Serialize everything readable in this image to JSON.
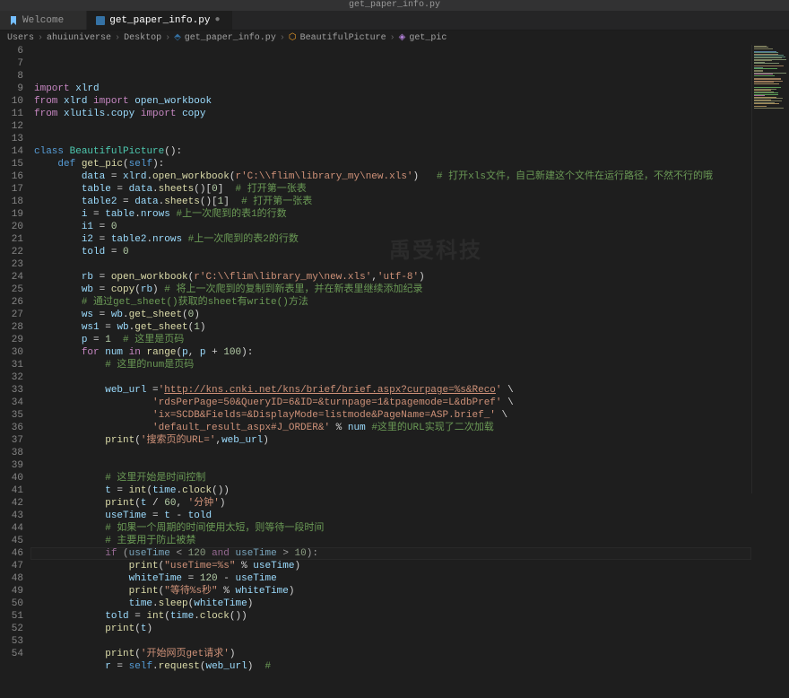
{
  "titlebar": "get_paper_info.py",
  "tabs": [
    {
      "icon": "bookmark-icon",
      "label": "Welcome",
      "active": false,
      "dirty": false
    },
    {
      "icon": "python-icon",
      "label": "get_paper_info.py",
      "active": true,
      "dirty": true
    }
  ],
  "breadcrumbs": [
    "Users",
    "ahuiuniverse",
    "Desktop",
    "get_paper_info.py",
    "BeautifulPicture",
    "get_pic"
  ],
  "crumb_icons": [
    "",
    "",
    "",
    "py",
    "class",
    "method"
  ],
  "watermark": "禹受科技",
  "lines": [
    {
      "n": 6,
      "tokens": [
        [
          "kw",
          "import"
        ],
        [
          "op",
          " "
        ],
        [
          "var",
          "xlrd"
        ]
      ]
    },
    {
      "n": 7,
      "tokens": [
        [
          "kw",
          "from"
        ],
        [
          "op",
          " "
        ],
        [
          "var",
          "xlrd"
        ],
        [
          "op",
          " "
        ],
        [
          "kw",
          "import"
        ],
        [
          "op",
          " "
        ],
        [
          "var",
          "open_workbook"
        ]
      ]
    },
    {
      "n": 8,
      "tokens": [
        [
          "kw",
          "from"
        ],
        [
          "op",
          " "
        ],
        [
          "var",
          "xlutils.copy"
        ],
        [
          "op",
          " "
        ],
        [
          "kw",
          "import"
        ],
        [
          "op",
          " "
        ],
        [
          "var",
          "copy"
        ]
      ]
    },
    {
      "n": 9,
      "tokens": []
    },
    {
      "n": 10,
      "tokens": []
    },
    {
      "n": 11,
      "tokens": [
        [
          "kw2",
          "class"
        ],
        [
          "op",
          " "
        ],
        [
          "cls",
          "BeautifulPicture"
        ],
        [
          "punc",
          "():"
        ]
      ]
    },
    {
      "n": 12,
      "indent": 1,
      "tokens": [
        [
          "kw2",
          "def"
        ],
        [
          "op",
          " "
        ],
        [
          "fn",
          "get_pic"
        ],
        [
          "punc",
          "("
        ],
        [
          "self",
          "self"
        ],
        [
          "punc",
          "):"
        ]
      ]
    },
    {
      "n": 13,
      "indent": 2,
      "tokens": [
        [
          "var",
          "data"
        ],
        [
          "op",
          " = "
        ],
        [
          "var",
          "xlrd"
        ],
        [
          "punc",
          "."
        ],
        [
          "fn",
          "open_workbook"
        ],
        [
          "punc",
          "("
        ],
        [
          "str",
          "r'C:\\\\flim\\library_my\\new.xls'"
        ],
        [
          "punc",
          ")   "
        ],
        [
          "cmt",
          "# 打开xls文件，自己新建这个文件在运行路径，不然不行的哦"
        ]
      ]
    },
    {
      "n": 14,
      "indent": 2,
      "tokens": [
        [
          "var",
          "table"
        ],
        [
          "op",
          " = "
        ],
        [
          "var",
          "data"
        ],
        [
          "punc",
          "."
        ],
        [
          "fn",
          "sheets"
        ],
        [
          "punc",
          "()["
        ],
        [
          "num",
          "0"
        ],
        [
          "punc",
          "]  "
        ],
        [
          "cmt",
          "# 打开第一张表"
        ]
      ]
    },
    {
      "n": 15,
      "indent": 2,
      "tokens": [
        [
          "var",
          "table2"
        ],
        [
          "op",
          " = "
        ],
        [
          "var",
          "data"
        ],
        [
          "punc",
          "."
        ],
        [
          "fn",
          "sheets"
        ],
        [
          "punc",
          "()["
        ],
        [
          "num",
          "1"
        ],
        [
          "punc",
          "]  "
        ],
        [
          "cmt",
          "# 打开第一张表"
        ]
      ]
    },
    {
      "n": 16,
      "indent": 2,
      "tokens": [
        [
          "var",
          "i"
        ],
        [
          "op",
          " = "
        ],
        [
          "var",
          "table"
        ],
        [
          "punc",
          "."
        ],
        [
          "var",
          "nrows"
        ],
        [
          "op",
          " "
        ],
        [
          "cmt",
          "#上一次爬到的表1的行数"
        ]
      ]
    },
    {
      "n": 17,
      "indent": 2,
      "tokens": [
        [
          "var",
          "i1"
        ],
        [
          "op",
          " = "
        ],
        [
          "num",
          "0"
        ]
      ]
    },
    {
      "n": 18,
      "indent": 2,
      "tokens": [
        [
          "var",
          "i2"
        ],
        [
          "op",
          " = "
        ],
        [
          "var",
          "table2"
        ],
        [
          "punc",
          "."
        ],
        [
          "var",
          "nrows"
        ],
        [
          "op",
          " "
        ],
        [
          "cmt",
          "#上一次爬到的表2的行数"
        ]
      ]
    },
    {
      "n": 19,
      "indent": 2,
      "tokens": [
        [
          "var",
          "told"
        ],
        [
          "op",
          " = "
        ],
        [
          "num",
          "0"
        ]
      ]
    },
    {
      "n": 20,
      "indent": 2,
      "tokens": []
    },
    {
      "n": 21,
      "indent": 2,
      "tokens": [
        [
          "var",
          "rb"
        ],
        [
          "op",
          " = "
        ],
        [
          "fn",
          "open_workbook"
        ],
        [
          "punc",
          "("
        ],
        [
          "str",
          "r'C:\\\\flim\\library_my\\new.xls'"
        ],
        [
          "punc",
          ","
        ],
        [
          "str",
          "'utf-8'"
        ],
        [
          "punc",
          ")"
        ]
      ]
    },
    {
      "n": 22,
      "indent": 2,
      "tokens": [
        [
          "var",
          "wb"
        ],
        [
          "op",
          " = "
        ],
        [
          "fn",
          "copy"
        ],
        [
          "punc",
          "("
        ],
        [
          "var",
          "rb"
        ],
        [
          "punc",
          ") "
        ],
        [
          "cmt",
          "# 将上一次爬到的复制到新表里，并在新表里继续添加纪录"
        ]
      ]
    },
    {
      "n": 23,
      "indent": 2,
      "tokens": [
        [
          "cmt",
          "# 通过get_sheet()获取的sheet有write()方法"
        ]
      ]
    },
    {
      "n": 24,
      "indent": 2,
      "tokens": [
        [
          "var",
          "ws"
        ],
        [
          "op",
          " = "
        ],
        [
          "var",
          "wb"
        ],
        [
          "punc",
          "."
        ],
        [
          "fn",
          "get_sheet"
        ],
        [
          "punc",
          "("
        ],
        [
          "num",
          "0"
        ],
        [
          "punc",
          ")"
        ]
      ]
    },
    {
      "n": 25,
      "indent": 2,
      "tokens": [
        [
          "var",
          "ws1"
        ],
        [
          "op",
          " = "
        ],
        [
          "var",
          "wb"
        ],
        [
          "punc",
          "."
        ],
        [
          "fn",
          "get_sheet"
        ],
        [
          "punc",
          "("
        ],
        [
          "num",
          "1"
        ],
        [
          "punc",
          ")"
        ]
      ]
    },
    {
      "n": 26,
      "indent": 2,
      "tokens": [
        [
          "var",
          "p"
        ],
        [
          "op",
          " = "
        ],
        [
          "num",
          "1"
        ],
        [
          "op",
          "  "
        ],
        [
          "cmt",
          "# 这里是页码"
        ]
      ]
    },
    {
      "n": 27,
      "indent": 2,
      "tokens": [
        [
          "kw",
          "for"
        ],
        [
          "op",
          " "
        ],
        [
          "var",
          "num"
        ],
        [
          "op",
          " "
        ],
        [
          "kw",
          "in"
        ],
        [
          "op",
          " "
        ],
        [
          "fn",
          "range"
        ],
        [
          "punc",
          "("
        ],
        [
          "var",
          "p"
        ],
        [
          "punc",
          ", "
        ],
        [
          "var",
          "p"
        ],
        [
          "op",
          " + "
        ],
        [
          "num",
          "100"
        ],
        [
          "punc",
          "):"
        ]
      ]
    },
    {
      "n": 28,
      "indent": 3,
      "tokens": [
        [
          "cmt",
          "# 这里的num是页码"
        ]
      ]
    },
    {
      "n": 29,
      "indent": 2,
      "tokens": []
    },
    {
      "n": 30,
      "indent": 3,
      "tokens": [
        [
          "var",
          "web_url"
        ],
        [
          "op",
          " ="
        ],
        [
          "str",
          "'"
        ],
        [
          "strlink",
          "http://kns.cnki.net/kns/brief/brief.aspx?curpage=%s&Reco"
        ],
        [
          "str",
          "'"
        ],
        [
          "op",
          " \\"
        ]
      ]
    },
    {
      "n": 31,
      "indent": 5,
      "tokens": [
        [
          "str",
          "'rdsPerPage=50&QueryID=6&ID=&turnpage=1&tpagemode=L&dbPref'"
        ],
        [
          "op",
          " \\"
        ]
      ]
    },
    {
      "n": 32,
      "indent": 5,
      "tokens": [
        [
          "str",
          "'ix=SCDB&Fields=&DisplayMode=listmode&PageName=ASP.brief_'"
        ],
        [
          "op",
          " \\"
        ]
      ]
    },
    {
      "n": 33,
      "indent": 5,
      "tokens": [
        [
          "str",
          "'default_result_aspx#J_ORDER&'"
        ],
        [
          "op",
          " % "
        ],
        [
          "var",
          "num"
        ],
        [
          "op",
          " "
        ],
        [
          "cmt",
          "#这里的URL实现了二次加载"
        ]
      ]
    },
    {
      "n": 34,
      "indent": 3,
      "tokens": [
        [
          "fn",
          "print"
        ],
        [
          "punc",
          "("
        ],
        [
          "str",
          "'搜索页的URL='"
        ],
        [
          "punc",
          ","
        ],
        [
          "var",
          "web_url"
        ],
        [
          "punc",
          ")"
        ]
      ]
    },
    {
      "n": 35,
      "indent": 2,
      "tokens": []
    },
    {
      "n": 36,
      "indent": 2,
      "tokens": []
    },
    {
      "n": 37,
      "indent": 3,
      "tokens": [
        [
          "cmt",
          "# 这里开始是时间控制"
        ]
      ]
    },
    {
      "n": 38,
      "indent": 3,
      "tokens": [
        [
          "var",
          "t"
        ],
        [
          "op",
          " = "
        ],
        [
          "fn",
          "int"
        ],
        [
          "punc",
          "("
        ],
        [
          "var",
          "time"
        ],
        [
          "punc",
          "."
        ],
        [
          "fn",
          "clock"
        ],
        [
          "punc",
          "())"
        ]
      ]
    },
    {
      "n": 39,
      "indent": 3,
      "tokens": [
        [
          "fn",
          "print"
        ],
        [
          "punc",
          "("
        ],
        [
          "var",
          "t"
        ],
        [
          "op",
          " / "
        ],
        [
          "num",
          "60"
        ],
        [
          "punc",
          ", "
        ],
        [
          "str",
          "'分钟'"
        ],
        [
          "punc",
          ")"
        ]
      ]
    },
    {
      "n": 40,
      "indent": 3,
      "tokens": [
        [
          "var",
          "useTime"
        ],
        [
          "op",
          " = "
        ],
        [
          "var",
          "t"
        ],
        [
          "op",
          " - "
        ],
        [
          "var",
          "told"
        ]
      ]
    },
    {
      "n": 41,
      "indent": 3,
      "tokens": [
        [
          "cmt",
          "# 如果一个周期的时间使用太短，则等待一段时间"
        ]
      ]
    },
    {
      "n": 42,
      "indent": 3,
      "tokens": [
        [
          "cmt",
          "# 主要用于防止被禁"
        ]
      ]
    },
    {
      "n": 43,
      "indent": 3,
      "tokens": [
        [
          "kw",
          "if"
        ],
        [
          "op",
          " ("
        ],
        [
          "var",
          "useTime"
        ],
        [
          "op",
          " < "
        ],
        [
          "num",
          "120"
        ],
        [
          "op",
          " "
        ],
        [
          "kw",
          "and"
        ],
        [
          "op",
          " "
        ],
        [
          "var",
          "useTime"
        ],
        [
          "op",
          " > "
        ],
        [
          "num",
          "10"
        ],
        [
          "punc",
          "):"
        ]
      ]
    },
    {
      "n": 44,
      "indent": 4,
      "tokens": [
        [
          "fn",
          "print"
        ],
        [
          "punc",
          "("
        ],
        [
          "str",
          "\"useTime=%s\""
        ],
        [
          "op",
          " % "
        ],
        [
          "var",
          "useTime"
        ],
        [
          "punc",
          ")"
        ]
      ]
    },
    {
      "n": 45,
      "indent": 4,
      "tokens": [
        [
          "var",
          "whiteTime"
        ],
        [
          "op",
          " = "
        ],
        [
          "num",
          "120"
        ],
        [
          "op",
          " - "
        ],
        [
          "var",
          "useTime"
        ]
      ]
    },
    {
      "n": 46,
      "indent": 4,
      "current": true,
      "tokens": [
        [
          "fn",
          "print"
        ],
        [
          "punc",
          "("
        ],
        [
          "str",
          "\"等待%s秒\""
        ],
        [
          "op",
          " % "
        ],
        [
          "var",
          "whiteTime"
        ],
        [
          "punc",
          ")"
        ]
      ]
    },
    {
      "n": 47,
      "indent": 4,
      "tokens": [
        [
          "var",
          "time"
        ],
        [
          "punc",
          "."
        ],
        [
          "fn",
          "sleep"
        ],
        [
          "punc",
          "("
        ],
        [
          "var",
          "whiteTime"
        ],
        [
          "punc",
          ")"
        ]
      ]
    },
    {
      "n": 48,
      "indent": 3,
      "tokens": [
        [
          "var",
          "told"
        ],
        [
          "op",
          " = "
        ],
        [
          "fn",
          "int"
        ],
        [
          "punc",
          "("
        ],
        [
          "var",
          "time"
        ],
        [
          "punc",
          "."
        ],
        [
          "fn",
          "clock"
        ],
        [
          "punc",
          "())"
        ]
      ]
    },
    {
      "n": 49,
      "indent": 3,
      "tokens": [
        [
          "fn",
          "print"
        ],
        [
          "punc",
          "("
        ],
        [
          "var",
          "t"
        ],
        [
          "punc",
          ")"
        ]
      ]
    },
    {
      "n": 50,
      "indent": 2,
      "tokens": []
    },
    {
      "n": 51,
      "indent": 3,
      "tokens": [
        [
          "fn",
          "print"
        ],
        [
          "punc",
          "("
        ],
        [
          "str",
          "'开始网页get请求'"
        ],
        [
          "punc",
          ")"
        ]
      ]
    },
    {
      "n": 52,
      "indent": 3,
      "tokens": [
        [
          "var",
          "r"
        ],
        [
          "op",
          " = "
        ],
        [
          "self",
          "self"
        ],
        [
          "punc",
          "."
        ],
        [
          "fn",
          "request"
        ],
        [
          "punc",
          "("
        ],
        [
          "var",
          "web_url"
        ],
        [
          "punc",
          ")  "
        ],
        [
          "cmt",
          "#"
        ]
      ]
    },
    {
      "n": 53,
      "indent": 2,
      "tokens": []
    },
    {
      "n": 54,
      "indent": 2,
      "tokens": []
    }
  ],
  "minimap_colors": [
    "#7a7a5a",
    "#7a7a5a",
    "#7a7a5a",
    "",
    "#557799",
    "#5a8a7a",
    "#9a7a5a",
    "#5a8a7a",
    "#5a8a7a",
    "#7a7a5a",
    "#7a8a6a",
    "#7a7a5a",
    "#7a8a6a",
    "#7a8a6a",
    "",
    "#9a7a5a",
    "#5a8a7a",
    "#5a9955",
    "#7a7a5a",
    "#7a7a5a",
    "#7a8a6a",
    "#aa6699",
    "#5a9955",
    "",
    "#9a7a5a",
    "#9a7a5a",
    "#9a7a5a",
    "#9a7a5a",
    "#a38a5a",
    "",
    "",
    "#5a9955",
    "#7a7a5a",
    "#a38a5a",
    "#7a7a5a",
    "#5a9955",
    "#5a9955",
    "#aa6699",
    "#a38a5a",
    "#7a7a5a",
    "#a38a5a",
    "#7a7a5a",
    "#7a7a5a",
    "#a38a5a",
    "",
    "#a38a5a",
    "#7a7a5a",
    "",
    ""
  ]
}
